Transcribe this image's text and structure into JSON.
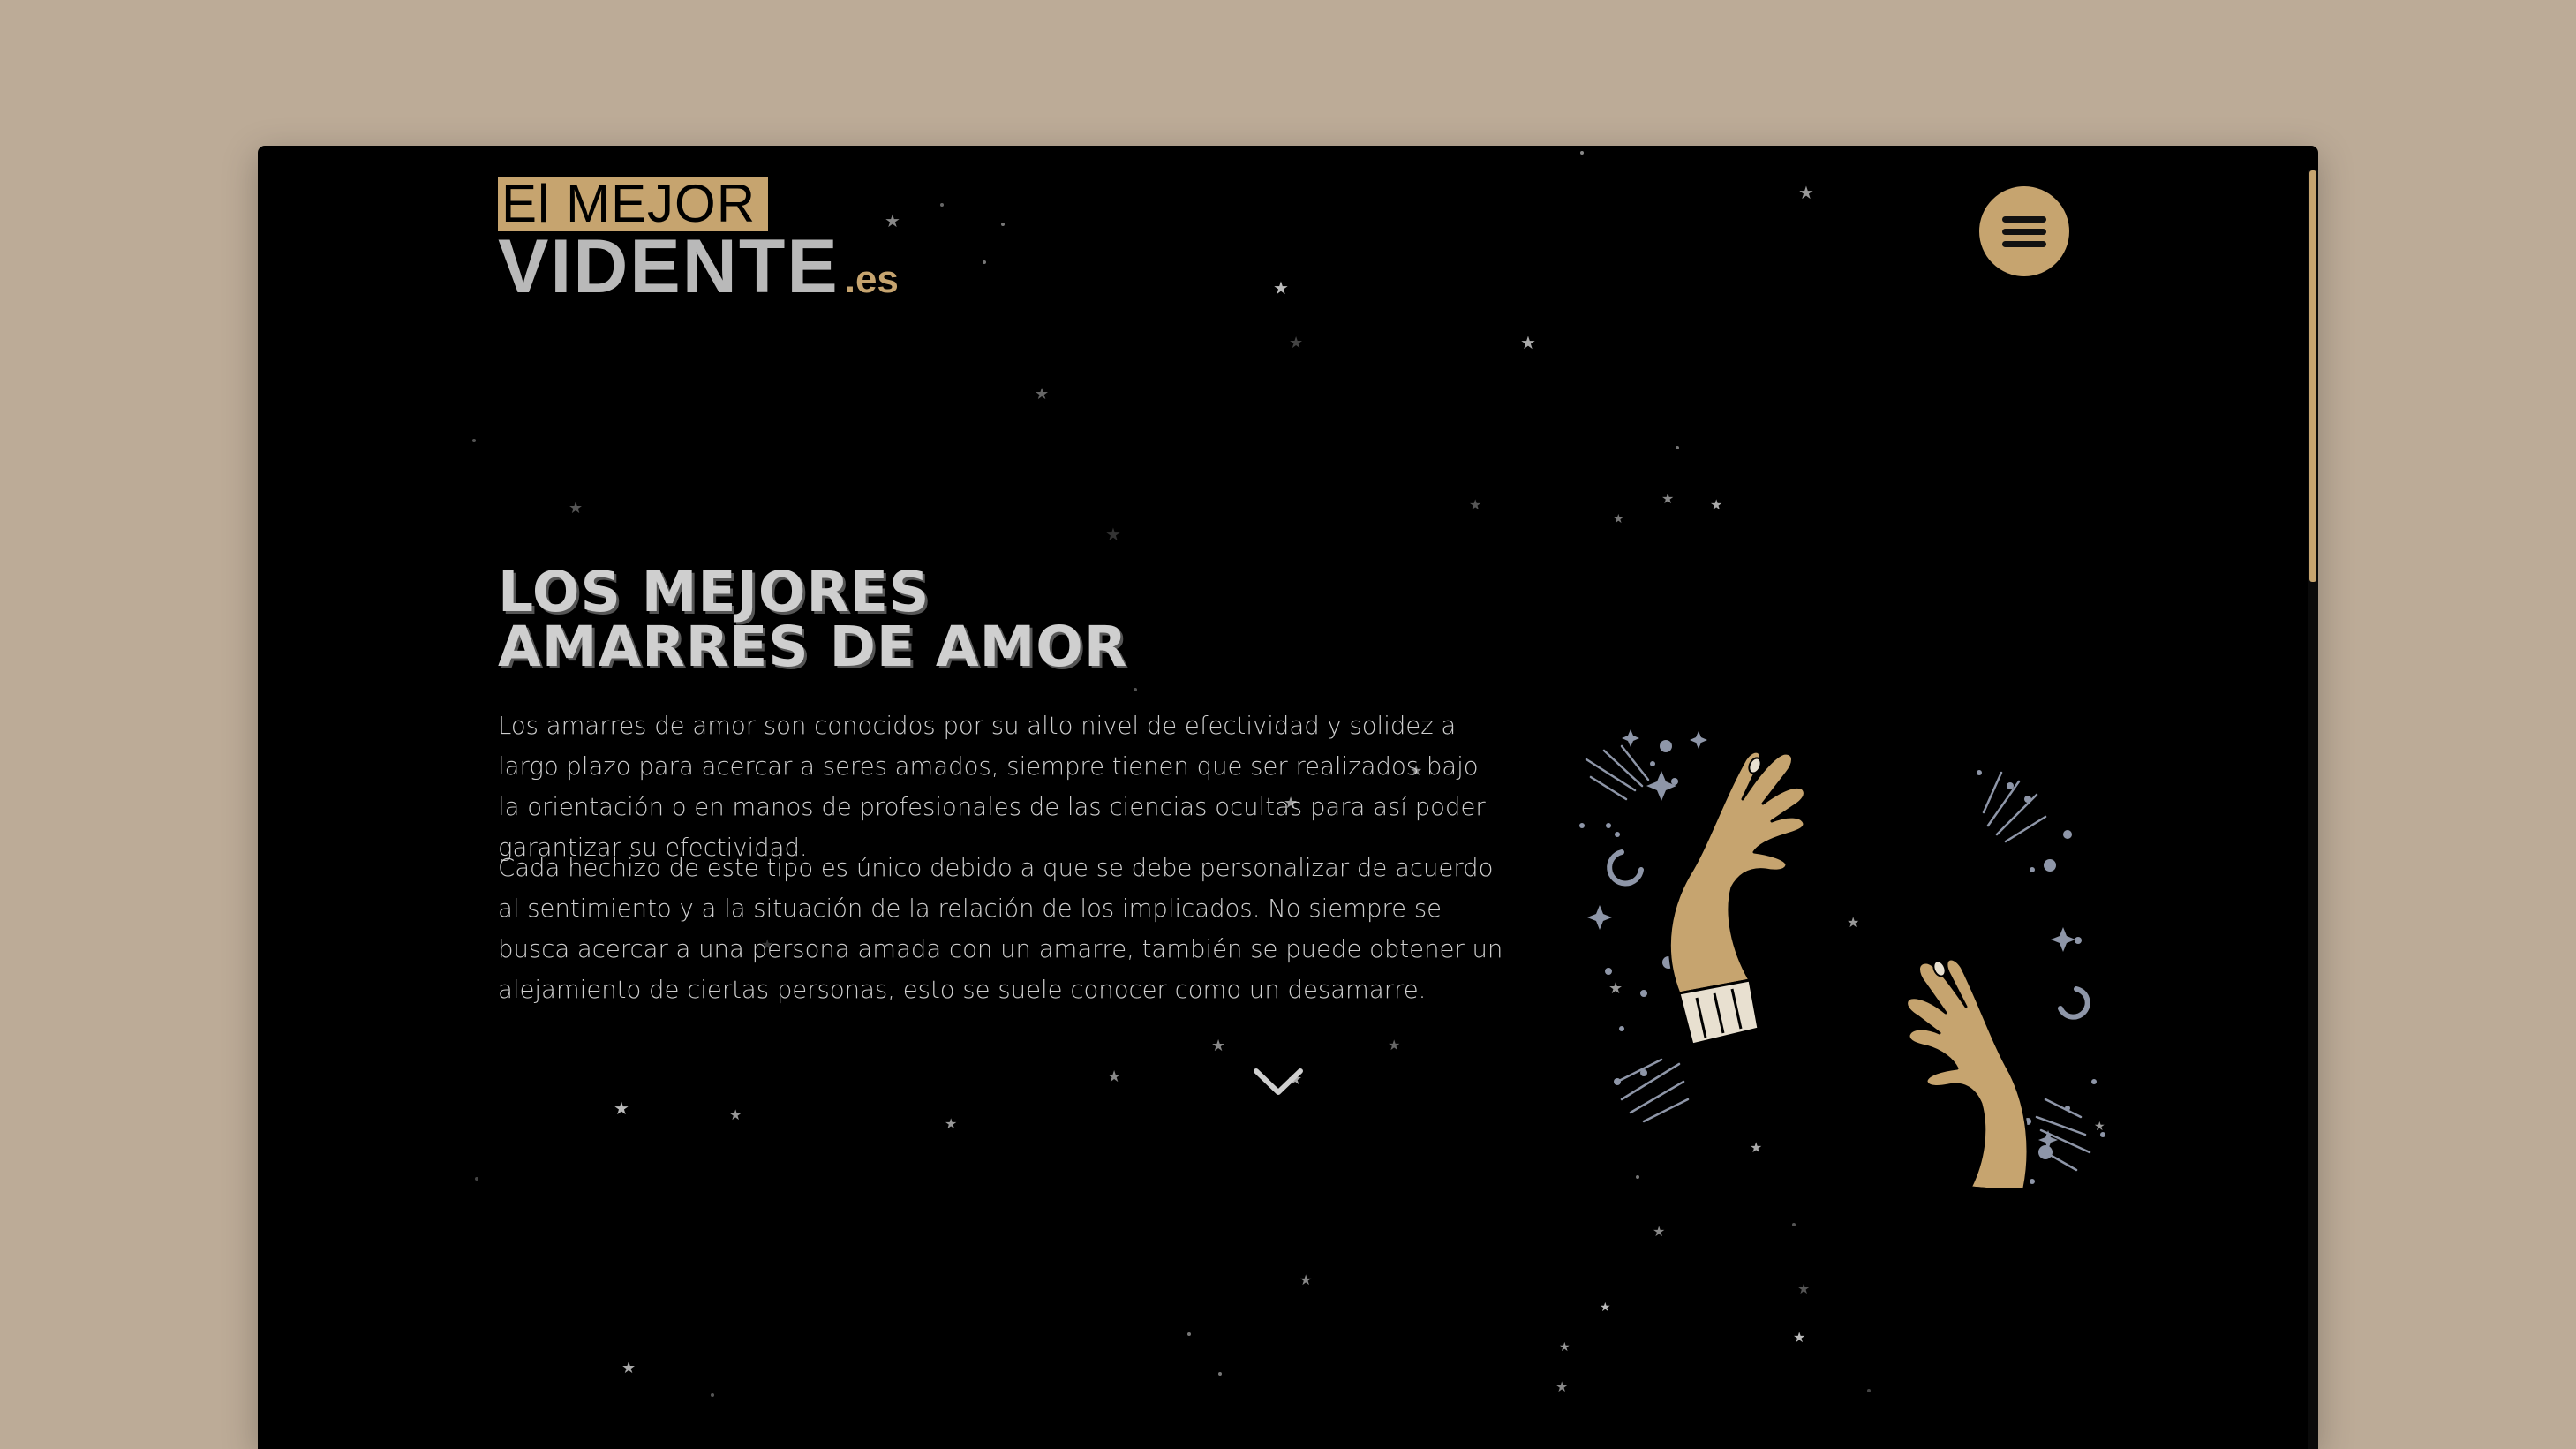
{
  "colors": {
    "background": "#bcab97",
    "page": "#000000",
    "accent": "#c6a46f",
    "text": "#cfcfcf"
  },
  "logo": {
    "top": "El MEJOR",
    "main": "VIDENTE",
    "suffix": ".es"
  },
  "header": {
    "menu_icon": "hamburger-icon"
  },
  "hero": {
    "title_line1": "LOS MEJORES",
    "title_line2": "AMARRES DE AMOR",
    "paragraph1": "Los amarres de amor son conocidos por su alto nivel de efectividad y solidez a largo plazo para acercar a seres amados, siempre tienen que ser realizados bajo la orientación o en manos de profesionales de las ciencias ocultas para así poder garantizar su efectividad.",
    "paragraph2": "Cada hechizo de este tipo es único debido a que se debe personalizar de acuerdo al sentimiento y a la situación de la relación de los implicados. No siempre se busca acercar a una persona amada con un amarre, también se puede obtener un alejamiento de ciertas personas, esto se suele conocer como un desamarre.",
    "scroll_icon": "chevron-down-icon",
    "illustration_icon": "mystic-hands-icon"
  }
}
